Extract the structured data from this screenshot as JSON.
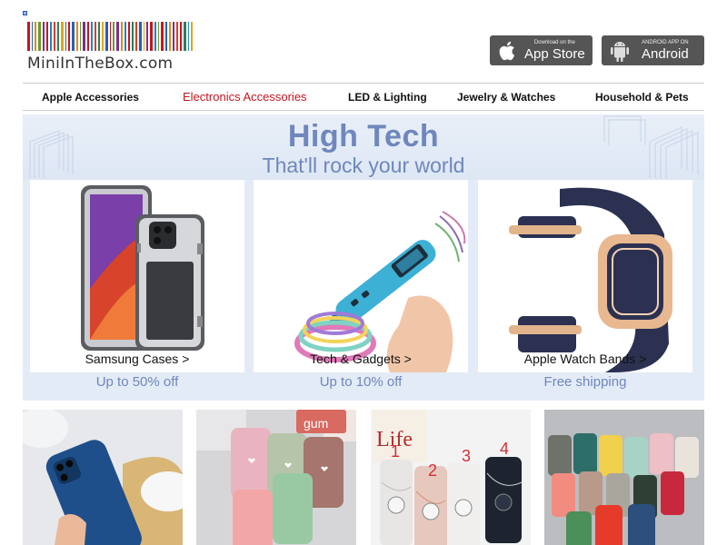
{
  "logo": {
    "text": "MiniInTheBox.com",
    "barcode_colors": [
      "#c8141e",
      "#2d5fa8",
      "#e08a14",
      "#6a9a2c",
      "#7a2f8f",
      "#c8141e",
      "#1f86c9",
      "#d6402a",
      "#2f7d5c",
      "#e0a514",
      "#5a5a5a",
      "#c8141e",
      "#2d5fa8",
      "#e08a14",
      "#6a9a2c",
      "#7a2f8f",
      "#c8141e",
      "#1f86c9",
      "#d6402a",
      "#2f7d5c",
      "#e0a514",
      "#2d5fa8",
      "#c8141e",
      "#6a9a2c",
      "#7a2f8f",
      "#e08a14",
      "#1f86c9",
      "#c8141e",
      "#2f7d5c",
      "#d6402a",
      "#2d5fa8",
      "#e0a514",
      "#7a2f8f",
      "#c8141e",
      "#1f86c9",
      "#6a9a2c",
      "#c8141e",
      "#2d5fa8",
      "#e08a14",
      "#7a2f8f",
      "#d6402a",
      "#c8141e",
      "#2f7d5c",
      "#1f86c9",
      "#e0a514"
    ]
  },
  "badges": {
    "appstore_small": "Download on the",
    "appstore_big": "App Store",
    "android_small": "ANDROID APP ON",
    "android_big": "Android"
  },
  "nav": {
    "items": [
      "Apple Accessories",
      "Electronics Accessories",
      "LED & Lighting",
      "Jewelry & Watches",
      "Household & Pets"
    ],
    "active_index": 1
  },
  "hero": {
    "title": "High Tech",
    "subtitle": "That'll rock your world",
    "cards": [
      {
        "label": "Samsung Cases >",
        "offer": "Up to 50% off"
      },
      {
        "label": "Tech & Gadgets >",
        "offer": "Up to 10% off"
      },
      {
        "label": "Apple Watch Bands >",
        "offer": "Free shipping"
      }
    ]
  },
  "tiles": {
    "tile3_numbers": [
      "1",
      "2",
      "3",
      "4"
    ],
    "tile2_pack_text": "gum"
  },
  "colors": {
    "hero_blue": "#6f87bd",
    "active_nav": "#c8141e",
    "badge_bg": "#555555"
  }
}
